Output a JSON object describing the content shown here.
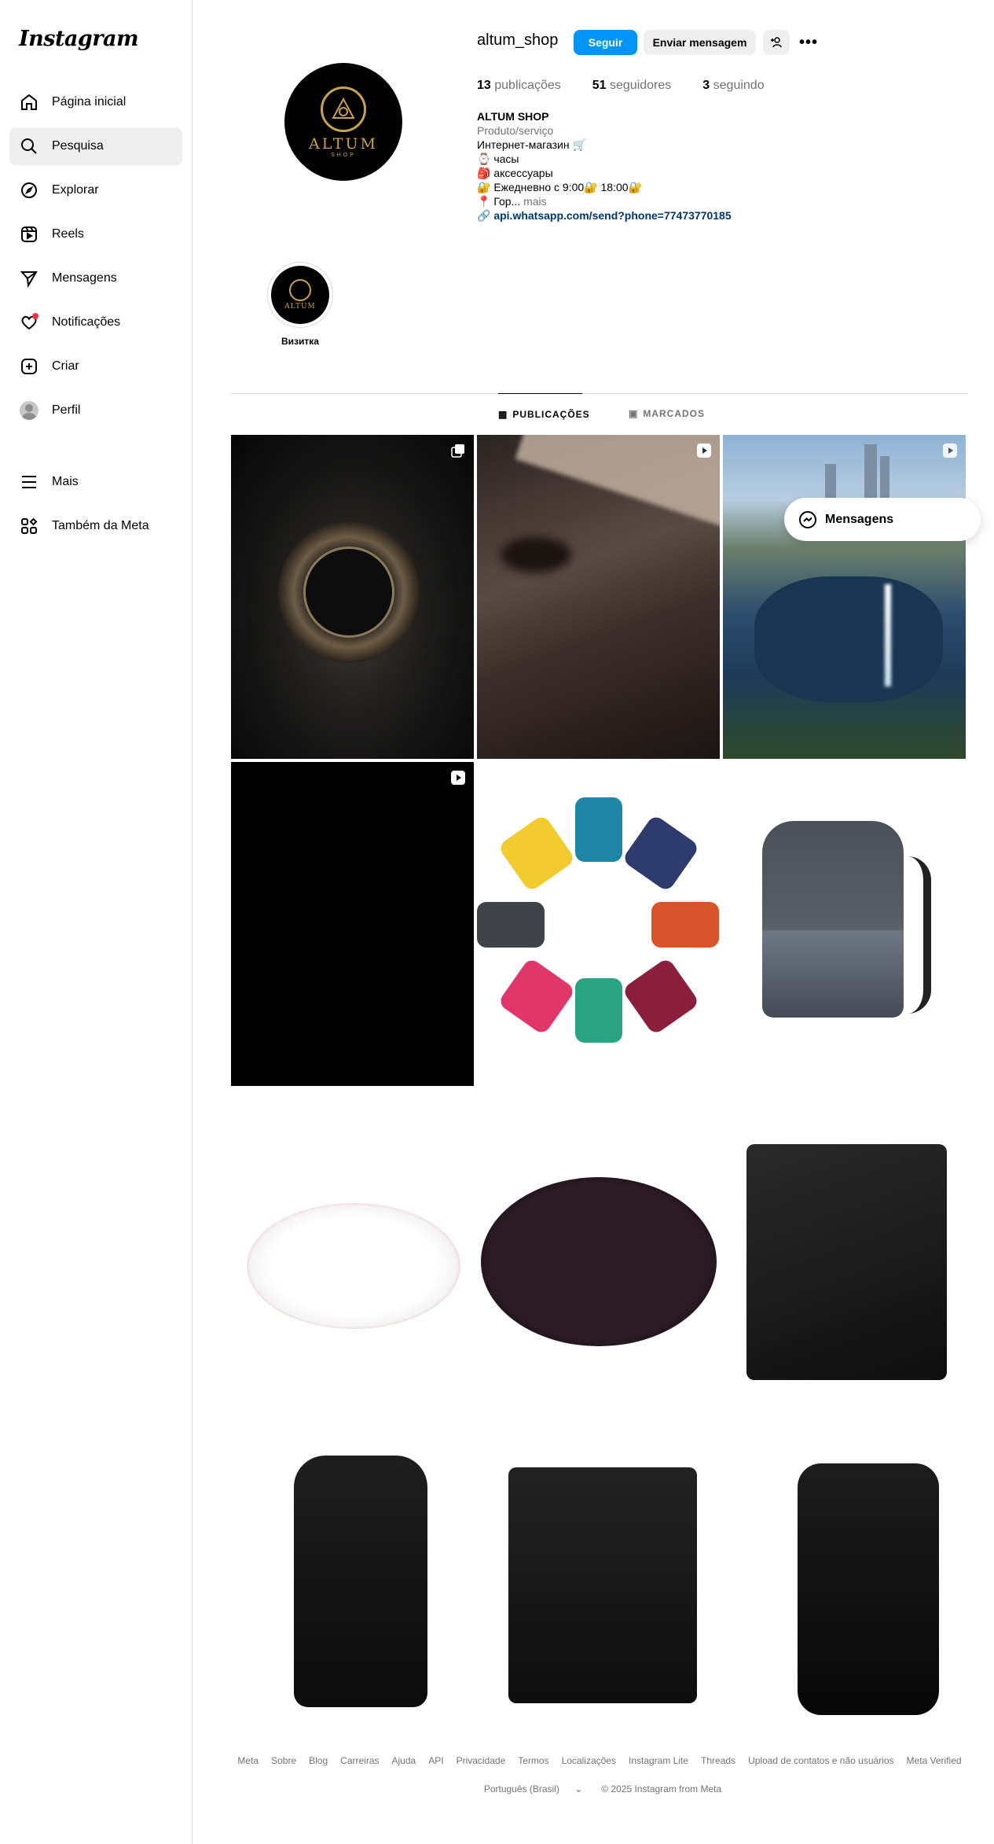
{
  "app": {
    "logo": "Instagram"
  },
  "sidebar": {
    "items": [
      {
        "label": "Página inicial",
        "icon": "home-icon"
      },
      {
        "label": "Pesquisa",
        "icon": "search-icon",
        "active": true
      },
      {
        "label": "Explorar",
        "icon": "compass-icon"
      },
      {
        "label": "Reels",
        "icon": "reels-icon"
      },
      {
        "label": "Mensagens",
        "icon": "send-icon"
      },
      {
        "label": "Notificações",
        "icon": "heart-icon"
      },
      {
        "label": "Criar",
        "icon": "plus-square-icon"
      },
      {
        "label": "Perfil",
        "icon": "avatar-icon"
      }
    ],
    "bottom": [
      {
        "label": "Mais",
        "icon": "menu-icon"
      },
      {
        "label": "Também da Meta",
        "icon": "meta-apps-icon"
      }
    ]
  },
  "profile": {
    "username": "altum_shop",
    "follow_label": "Seguir",
    "message_label": "Enviar mensagem",
    "more_label": "•••",
    "avatar_brand": "ALTUM",
    "avatar_sub": "SHOP",
    "stats": {
      "posts_count": "13",
      "posts_label": "publicações",
      "followers_count": "51",
      "followers_label": "seguidores",
      "following_count": "3",
      "following_label": "seguindo"
    },
    "bio": {
      "name": "ALTUM SHOP",
      "category": "Produto/serviço",
      "line1": "Интернет-магазин 🛒",
      "line2": "⌚ часы",
      "line3": "🎒 аксессуары",
      "line4": "🔐 Ежедневно с 9:00🔐 18:00🔐",
      "line5": "📍 Гор...",
      "more": "mais",
      "link": "api.whatsapp.com/send?phone=77473770185"
    }
  },
  "highlights": [
    {
      "label": "Визитка",
      "brand": "ALTUM"
    }
  ],
  "tabs": [
    {
      "label": "PUBLICAÇÕES",
      "icon": "grid-icon",
      "active": true
    },
    {
      "label": "MARCADOS",
      "icon": "tagged-icon",
      "active": false
    }
  ],
  "posts": [
    {
      "kind": "carousel",
      "subject": "watch"
    },
    {
      "kind": "reel",
      "subject": "blur"
    },
    {
      "kind": "reel",
      "subject": "city"
    },
    {
      "kind": "reel",
      "subject": "black"
    },
    {
      "kind": "image",
      "subject": "backpacks"
    },
    {
      "kind": "image",
      "subject": "gray-bag"
    },
    {
      "kind": "image",
      "subject": "white-charger"
    },
    {
      "kind": "image",
      "subject": "black-charger"
    },
    {
      "kind": "image",
      "subject": "black-messenger"
    },
    {
      "kind": "image",
      "subject": "tablet-bag"
    },
    {
      "kind": "image",
      "subject": "shoulder-bag"
    },
    {
      "kind": "image",
      "subject": "lambo-bag"
    }
  ],
  "floating_messages": {
    "label": "Mensagens"
  },
  "footer": {
    "links": [
      "Meta",
      "Sobre",
      "Blog",
      "Carreiras",
      "Ajuda",
      "API",
      "Privacidade",
      "Termos",
      "Localizações",
      "Instagram Lite",
      "Threads",
      "Upload de contatos e não usuários",
      "Meta Verified"
    ],
    "language": "Português (Brasil)",
    "copyright": "© 2025 Instagram from Meta"
  },
  "colors": {
    "accent": "#0095f6",
    "gold": "#c9a24a",
    "notif": "#ff3040"
  }
}
